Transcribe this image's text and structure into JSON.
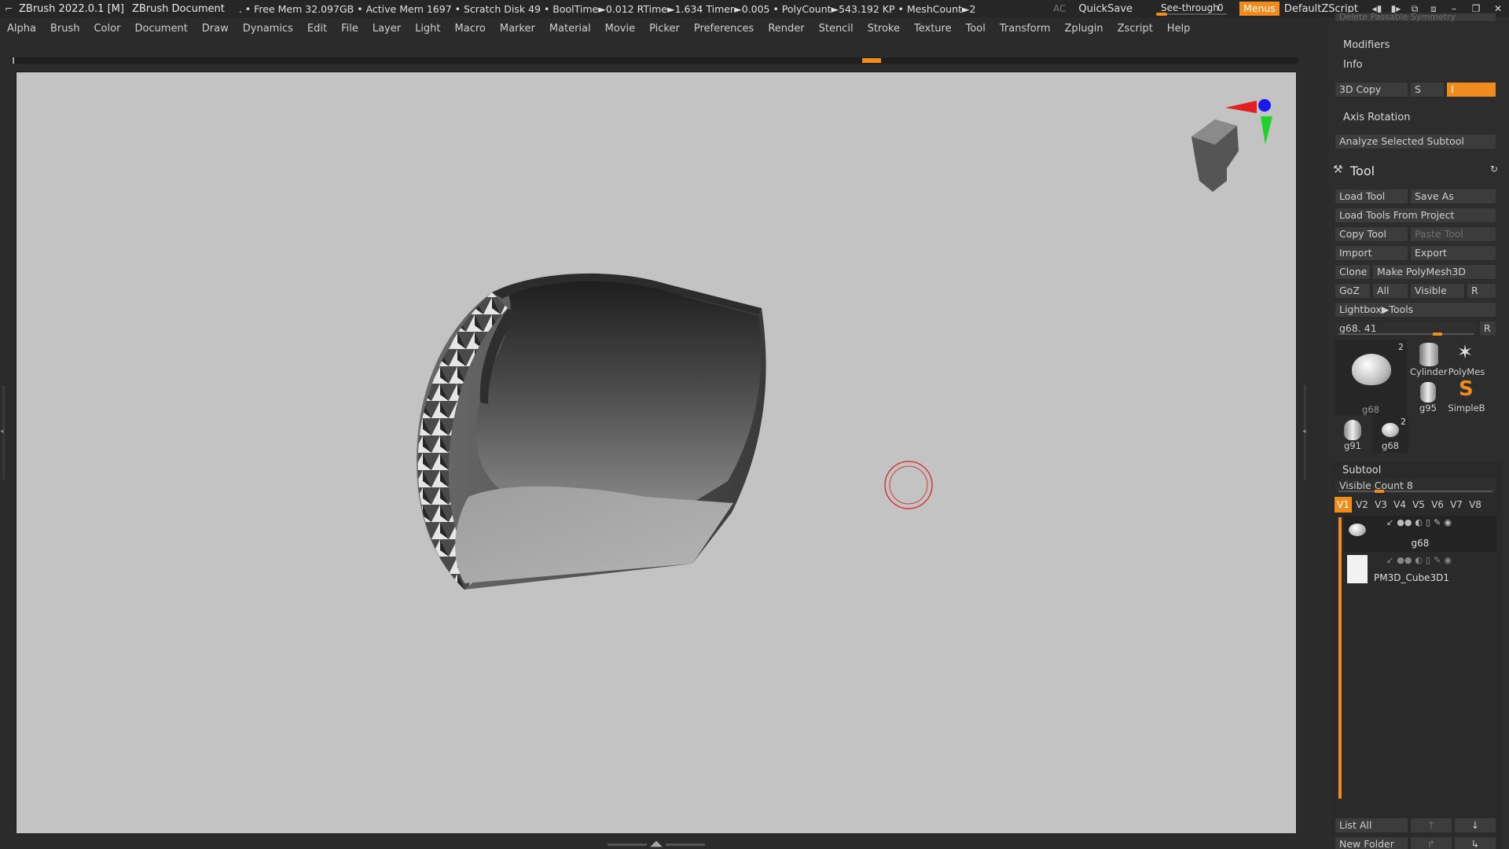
{
  "titlebar": {
    "app_title": "ZBrush 2022.0.1 [M]",
    "document": "ZBrush Document",
    "stats": ". • Free Mem 32.097GB • Active Mem 1697 • Scratch Disk 49 •  BoolTime►0.012 RTime►1.634 Timer►0.005 • PolyCount►543.192 KP  • MeshCount►2",
    "ac_label": "AC",
    "quicksave_label": "QuickSave",
    "seethrough_label": "See-through",
    "seethrough_value": "0",
    "menus_label": "Menus",
    "script_label": "DefaultZScript"
  },
  "menubar": {
    "items": [
      "Alpha",
      "Brush",
      "Color",
      "Document",
      "Draw",
      "Dynamics",
      "Edit",
      "File",
      "Layer",
      "Light",
      "Macro",
      "Marker",
      "Material",
      "Movie",
      "Picker",
      "Preferences",
      "Render",
      "Stencil",
      "Stroke",
      "Texture",
      "Tool",
      "Transform",
      "Zplugin",
      "Zscript",
      "Help"
    ]
  },
  "panel": {
    "top_cut_label": "Delete Passable Symmetry",
    "modifiers_label": "Modifiers",
    "info_label": "Info",
    "copy3d_label": "3D Copy",
    "s_label": "S",
    "i_label": "I",
    "axis_rotation_label": "Axis Rotation",
    "analyze_label": "Analyze Selected Subtool",
    "tool_title": "Tool",
    "load_tool": "Load Tool",
    "save_as": "Save As",
    "load_from_project": "Load Tools From Project",
    "copy_tool": "Copy Tool",
    "paste_tool": "Paste Tool",
    "import": "Import",
    "export": "Export",
    "clone": "Clone",
    "make_polymesh": "Make PolyMesh3D",
    "goz": "GoZ",
    "all": "All",
    "visible": "Visible",
    "r": "R",
    "lightbox_tools": "Lightbox▶Tools",
    "current_tool": "g68. 41",
    "thumbs": [
      {
        "cap": "g68",
        "badge": "2"
      },
      {
        "cap": "Cylinder"
      },
      {
        "cap": "PolyMes"
      },
      {
        "cap": "g95"
      },
      {
        "cap": "SimpleB"
      },
      {
        "cap": "g91"
      },
      {
        "cap": "g68",
        "badge": "2"
      }
    ],
    "subtool_title": "Subtool",
    "visible_count": "Visible Count 8",
    "vtabs": [
      "V1",
      "V2",
      "V3",
      "V4",
      "V5",
      "V6",
      "V7",
      "V8"
    ],
    "subtools": [
      "g68",
      "PM3D_Cube3D1"
    ],
    "list_all": "List All",
    "new_folder": "New Folder"
  },
  "colors": {
    "accent": "#f08b1d",
    "viewport_bg": "#c3c3c3",
    "brush_ring": "#d23c3c"
  },
  "icons": {
    "app": "zbrush-logo-icon",
    "gizmo": "navigation-head-gizmo-icon",
    "tool_title": "hammer-icon",
    "refresh": "refresh-icon"
  }
}
